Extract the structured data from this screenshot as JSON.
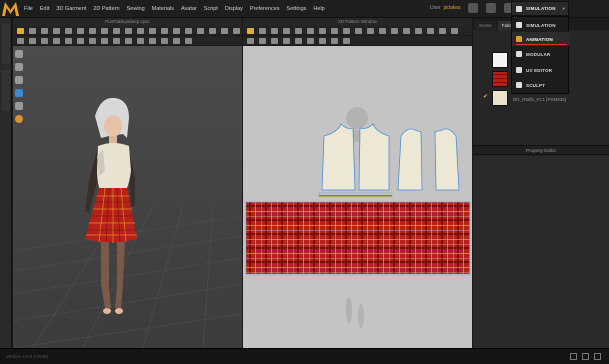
{
  "menu": [
    "File",
    "Edit",
    "3D Garment",
    "2D Pattern",
    "Sewing",
    "Materials",
    "Avatar",
    "Script",
    "Display",
    "Preferences",
    "Settings",
    "Help"
  ],
  "user": {
    "label": "User",
    "name": "jsdakes"
  },
  "window3d": {
    "title": "PunPakleyadeep.zpac"
  },
  "window2d": {
    "title": "2D Pattern Window"
  },
  "right_tabs": [
    "Scene",
    "Fabric",
    "Button",
    "Topstitch"
  ],
  "objects": [
    {
      "label": "",
      "swatch": "#f4f4f4",
      "checked": false
    },
    {
      "label": "",
      "swatch": "plaid",
      "checked": false
    },
    {
      "label": "Dfc_Rtaflir_FC1 [PSM936]",
      "swatch": "#ece2cc",
      "checked": true
    }
  ],
  "property_editor": {
    "title": "Property Editor"
  },
  "mode": {
    "current": "SIMULATION",
    "options": [
      "SIMULATION",
      "ANIMATION",
      "MODULAR",
      "UV EDITOR",
      "SCULPT"
    ],
    "highlighted": "ANIMATION"
  },
  "status": {
    "version": "Version 4.0.5 (r2048)"
  },
  "colors": {
    "accent": "#e0a020",
    "plaid_red": "#b8201a",
    "panel_cream": "#ede7d6",
    "selection_line": "#e03030"
  }
}
